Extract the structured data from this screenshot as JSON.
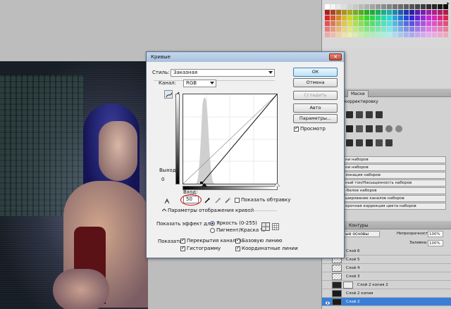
{
  "dialog": {
    "title": "Кривые",
    "style_label": "Стиль:",
    "style_value": "Заказная",
    "channel_label": "Канал:",
    "channel_value": "RGB",
    "output_label": "Выход:",
    "output_value": "0",
    "input_label": "Вход:",
    "input_value": "50",
    "show_clipping": "Показать обтравку",
    "curve_options": "Параметры отображения кривой",
    "show_effect_for": "Показать эффект для:",
    "radio_light": "Яркость (0-255)",
    "radio_pigment": "Пигмент/Краска %",
    "show_label": "Показать:",
    "cb_overlay": "Перекрытия каналов",
    "cb_baseline": "Базовую линию",
    "cb_histogram": "Гистограмму",
    "cb_intersection": "Координатные линии",
    "buttons": {
      "ok": "ОК",
      "cancel": "Отмена",
      "smooth": "Сгладить",
      "auto": "Авто",
      "options": "Параметры...",
      "preview": "Просмотр"
    }
  },
  "adjustments": {
    "tab_label": "Маски",
    "add_label": "корректировку",
    "presets": [
      "ни наборов",
      "ни наборов",
      "лонация наборов",
      "ный тон/Насыщенность наборов",
      "-белое наборов",
      "ширование каналов наборов",
      "орочная коррекция цвета наборов"
    ]
  },
  "layers": {
    "tab_label": "Контуры",
    "blend_mode": "ые основы",
    "opacity_label": "Непрозрачность:",
    "opacity_value": "100%",
    "fill_label": "Заливка:",
    "fill_value": "100%",
    "items": [
      "Слой 6",
      "Слой 5",
      "Слой 4",
      "Слой 3",
      "Слой 2 копия 2",
      "Слой 2 копия",
      "Слой 2"
    ]
  }
}
